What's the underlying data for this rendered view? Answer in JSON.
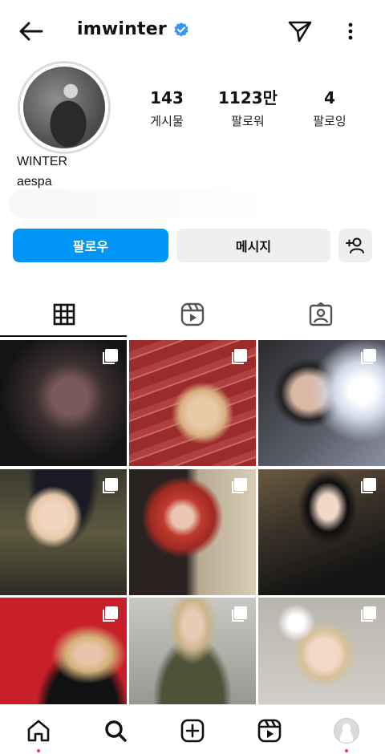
{
  "header": {
    "username": "imwinter"
  },
  "stats": [
    {
      "num": "143",
      "label": "게시물"
    },
    {
      "num": "1123만",
      "label": "팔로워"
    },
    {
      "num": "4",
      "label": "팔로잉"
    }
  ],
  "profile": {
    "name": "WINTER",
    "bio": "aespa"
  },
  "buttons": {
    "follow": "팔로우",
    "message": "메시지"
  },
  "colors": {
    "accent": "#0095f6",
    "verified": "#3897f0",
    "notification_dot": "#ff3040"
  },
  "tabs": [
    "grid-icon",
    "reels-icon",
    "tagged-icon"
  ],
  "nav": [
    "home-icon",
    "search-icon",
    "create-icon",
    "reels-icon",
    "profile-avatar"
  ]
}
